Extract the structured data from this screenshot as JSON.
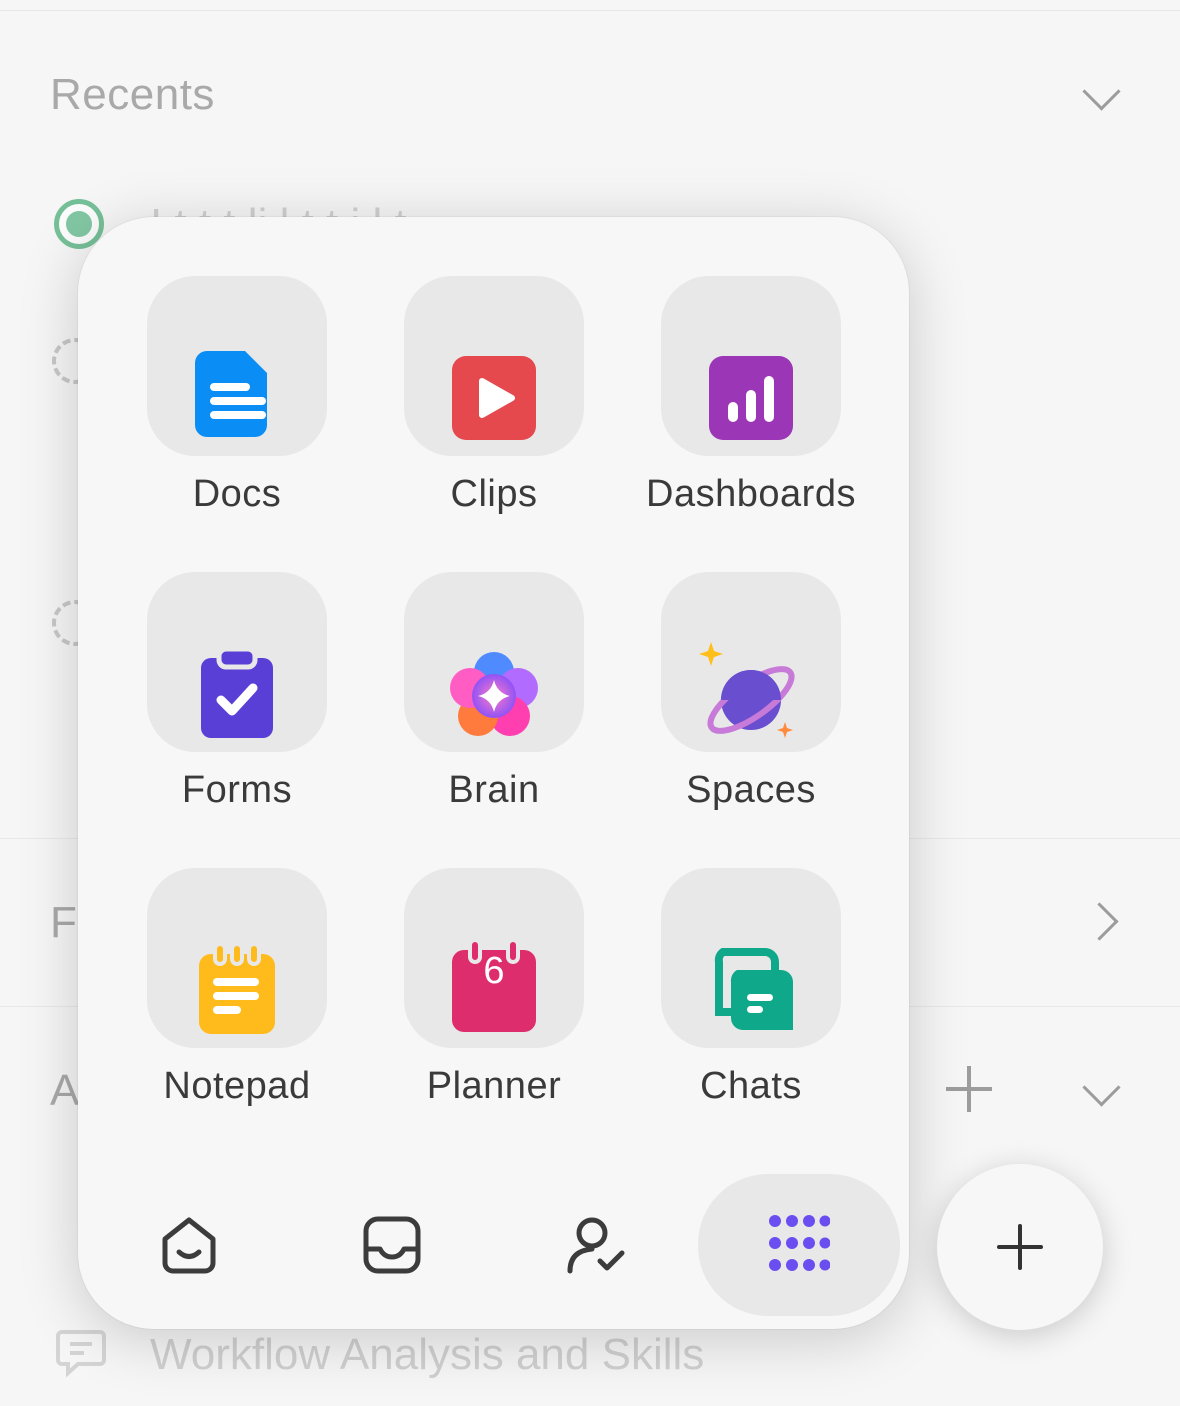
{
  "background": {
    "recents_title": "Recents",
    "favorites_title_fragment": "F",
    "all_title_fragment": "A",
    "recent_item_1_fragment": "I  t  t  t  li     l  t        t  i  l  t",
    "bottom_item": "Workflow Analysis and Skills"
  },
  "apps": [
    {
      "label": "Docs",
      "icon": "docs-icon",
      "color": "#0a8ef5"
    },
    {
      "label": "Clips",
      "icon": "clips-icon",
      "color": "#e5484d"
    },
    {
      "label": "Dashboards",
      "icon": "dashboards-icon",
      "color": "#9b36b7"
    },
    {
      "label": "Forms",
      "icon": "forms-icon",
      "color": "#5a3fd6"
    },
    {
      "label": "Brain",
      "icon": "brain-icon",
      "color": "#e957c8"
    },
    {
      "label": "Spaces",
      "icon": "spaces-icon",
      "color": "#6a4ed0"
    },
    {
      "label": "Notepad",
      "icon": "notepad-icon",
      "color": "#ffbb1c"
    },
    {
      "label": "Planner",
      "icon": "planner-icon",
      "color": "#de2d6c",
      "badge": "6"
    },
    {
      "label": "Chats",
      "icon": "chats-icon",
      "color": "#10a88a"
    }
  ],
  "dock": [
    {
      "name": "home",
      "icon": "home-icon",
      "active": false
    },
    {
      "name": "inbox",
      "icon": "inbox-icon",
      "active": false
    },
    {
      "name": "assigned",
      "icon": "person-check-icon",
      "active": false
    },
    {
      "name": "more",
      "icon": "grid-dots-icon",
      "active": true
    }
  ],
  "accent": "#6b4ef0"
}
